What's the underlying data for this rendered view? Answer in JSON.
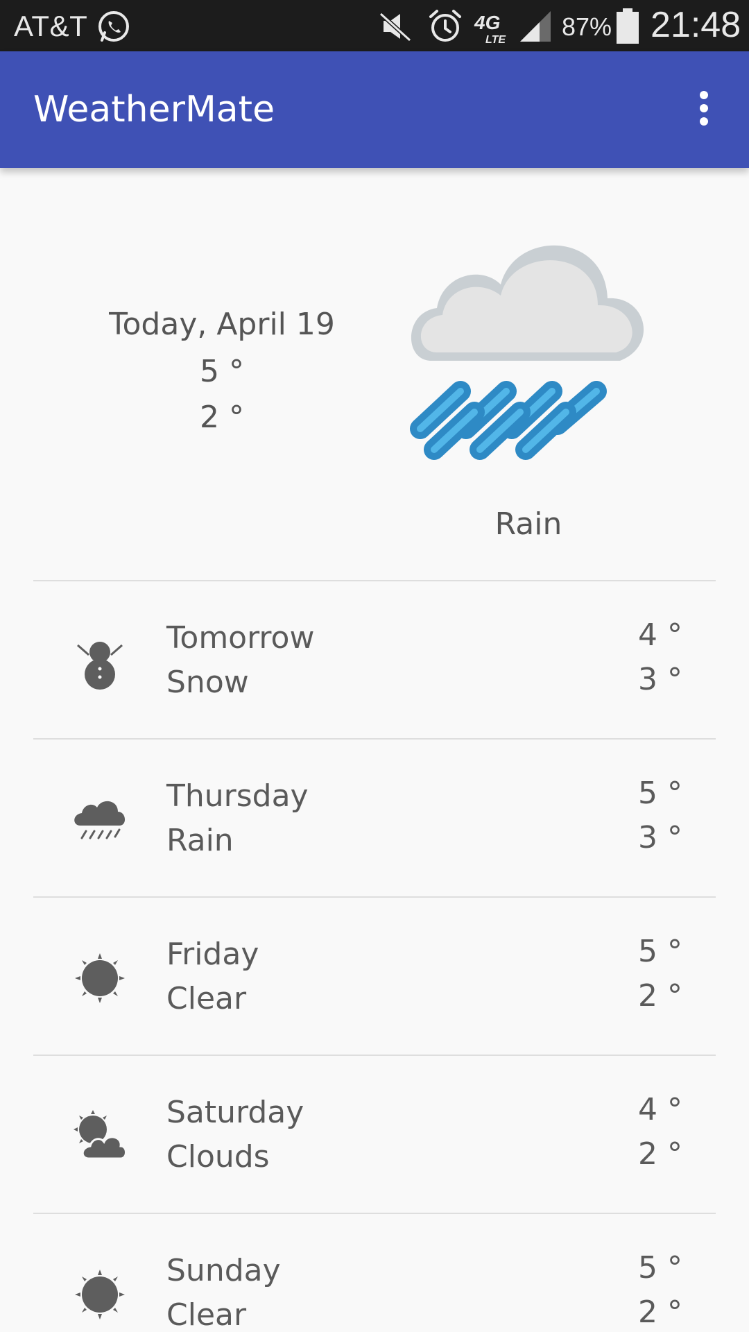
{
  "status_bar": {
    "carrier": "AT&T",
    "battery": "87%",
    "time": "21:48",
    "network": "4G LTE"
  },
  "app_bar": {
    "title": "WeatherMate",
    "menu_icon": "more-vert-icon"
  },
  "today": {
    "date": "Today, April 19",
    "high": "5 °",
    "low": "2 °",
    "condition": "Rain",
    "icon": "rain-art"
  },
  "forecast": [
    {
      "day": "Tomorrow",
      "condition": "Snow",
      "high": "4 °",
      "low": "3 °",
      "icon": "snow-icon"
    },
    {
      "day": "Thursday",
      "condition": "Rain",
      "high": "5 °",
      "low": "3 °",
      "icon": "rain-icon"
    },
    {
      "day": "Friday",
      "condition": "Clear",
      "high": "5 °",
      "low": "2 °",
      "icon": "sun-icon"
    },
    {
      "day": "Saturday",
      "condition": "Clouds",
      "high": "4 °",
      "low": "2 °",
      "icon": "clouds-icon"
    },
    {
      "day": "Sunday",
      "condition": "Clear",
      "high": "5 °",
      "low": "2 °",
      "icon": "sun-icon"
    }
  ],
  "colors": {
    "app_bar": "#3f51b5",
    "status_bar": "#1c1c1c",
    "background": "#f9f9f9",
    "text": "#5a5a5a",
    "rain_blue": "#2e8ac5"
  }
}
